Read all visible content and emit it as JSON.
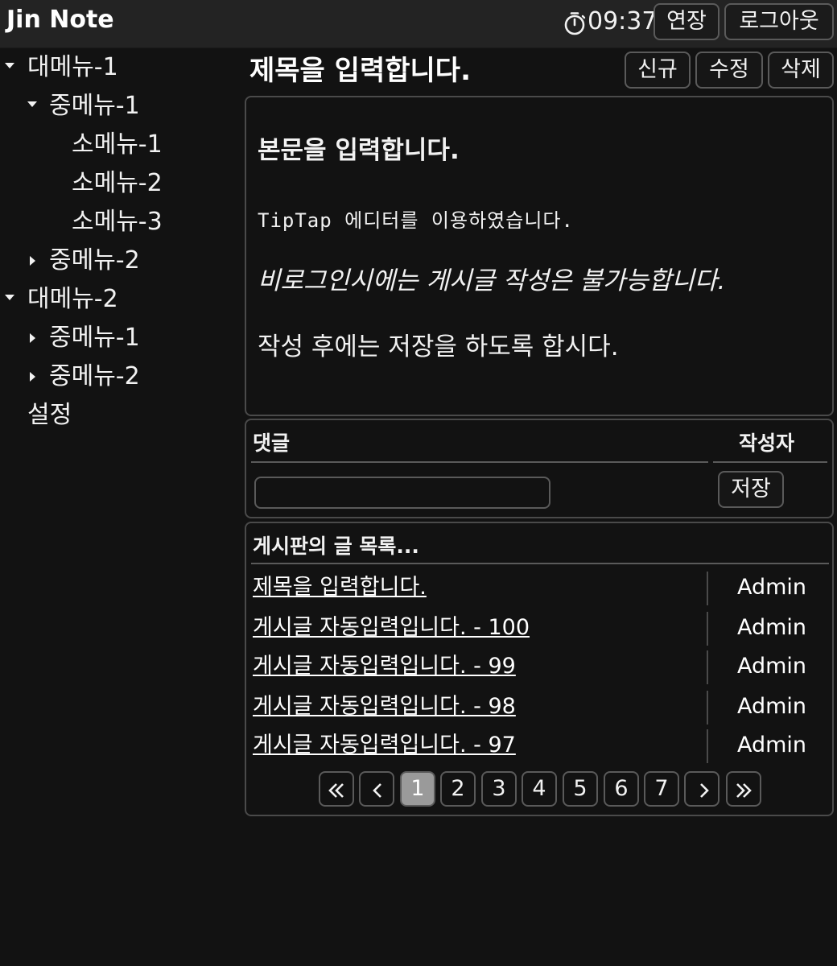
{
  "header": {
    "app_title": "Jin Note",
    "timer": "09:37",
    "extend_label": "연장",
    "logout_label": "로그아웃",
    "timer_icon": "stopwatch-icon"
  },
  "sidebar": {
    "items": [
      {
        "label": "대메뉴-1",
        "icon": "caret-down-icon"
      },
      {
        "label": "중메뉴-1",
        "icon": "caret-down-icon"
      },
      {
        "label": "소메뉴-1"
      },
      {
        "label": "소메뉴-2"
      },
      {
        "label": "소메뉴-3"
      },
      {
        "label": "중메뉴-2",
        "icon": "caret-right-icon"
      },
      {
        "label": "대메뉴-2",
        "icon": "caret-down-icon"
      },
      {
        "label": "중메뉴-1",
        "icon": "caret-right-icon"
      },
      {
        "label": "중메뉴-2",
        "icon": "caret-right-icon"
      },
      {
        "label": "설정"
      }
    ]
  },
  "post": {
    "title": "제목을 입력합니다.",
    "new_label": "신규",
    "edit_label": "수정",
    "delete_label": "삭제"
  },
  "editor": {
    "heading": "본문을 입력합니다.",
    "code_line": "TipTap 에디터를 이용하였습니다.",
    "italic_line": "비로그인시에는 게시글 작성은 불가능합니다.",
    "normal_line": "작성 후에는 저장을 하도록 합시다."
  },
  "comment": {
    "header_comment": "댓글",
    "header_author": "작성자",
    "input_value": "",
    "save_label": "저장"
  },
  "board": {
    "title": "게시판의 글 목록...",
    "rows": [
      {
        "title": "제목을 입력합니다.",
        "author": "Admin"
      },
      {
        "title": "게시글 자동입력입니다. - 100",
        "author": "Admin"
      },
      {
        "title": "게시글 자동입력입니다. - 99",
        "author": "Admin"
      },
      {
        "title": "게시글 자동입력입니다. - 98",
        "author": "Admin"
      },
      {
        "title": "게시글 자동입력입니다. - 97",
        "author": "Admin"
      }
    ]
  },
  "pagination": {
    "pages": [
      "1",
      "2",
      "3",
      "4",
      "5",
      "6",
      "7"
    ],
    "current": "1",
    "first_icon": "double-chevron-left-icon",
    "prev_icon": "chevron-left-icon",
    "next_icon": "chevron-right-icon",
    "last_icon": "double-chevron-right-icon"
  },
  "colors": {
    "background": "#121212",
    "header_background": "#232323",
    "border": "#5a5a5a",
    "active_page": "#9a9a9a",
    "text": "#f2f2f2"
  }
}
